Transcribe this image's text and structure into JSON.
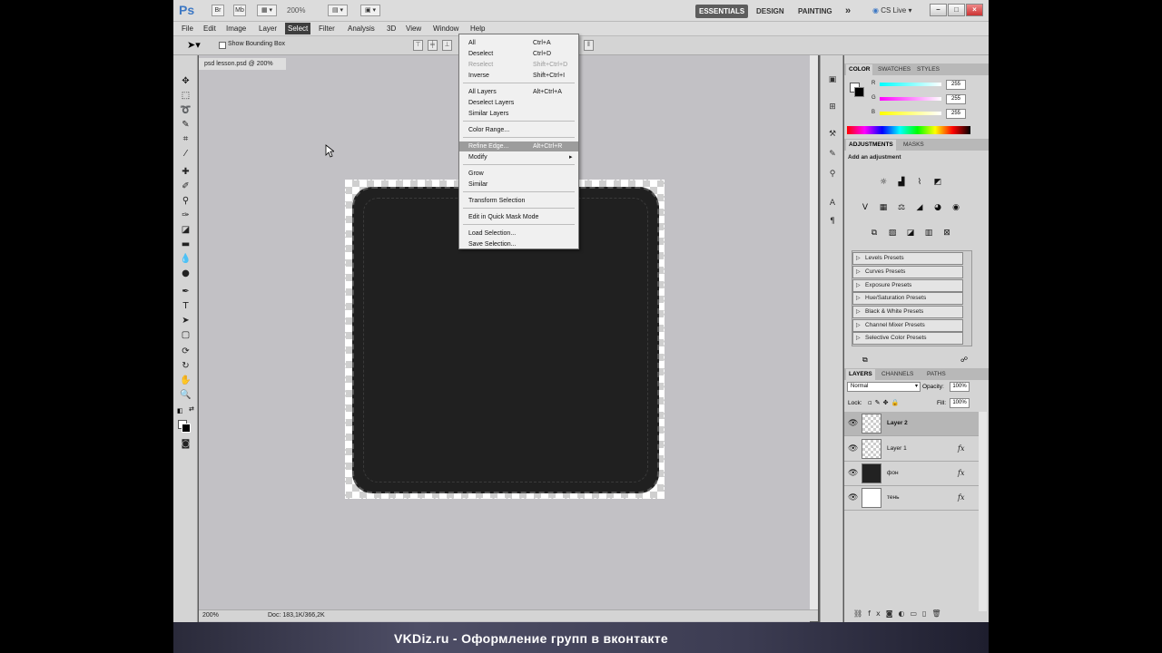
{
  "app": {
    "logo": "Ps",
    "bar_buttons": [
      "Br",
      "Mb"
    ],
    "zoom": "200%",
    "workspaces": [
      "ESSENTIALS",
      "DESIGN",
      "PAINTING"
    ],
    "more": "»",
    "cs_live": "CS Live",
    "window_controls": [
      "–",
      "□",
      "×"
    ]
  },
  "menubar": [
    "File",
    "Edit",
    "Image",
    "Layer",
    "Select",
    "Filter",
    "Analysis",
    "3D",
    "View",
    "Window",
    "Help"
  ],
  "options": {
    "show_bounding_box": "Show Bounding Box"
  },
  "document": {
    "tab": "psd lesson.psd @ 200%"
  },
  "status": {
    "zoom": "200%",
    "doc": "Doc: 183,1K/366,2K"
  },
  "select_menu": [
    {
      "label": "All",
      "shortcut": "Ctrl+A"
    },
    {
      "label": "Deselect",
      "shortcut": "Ctrl+D"
    },
    {
      "label": "Reselect",
      "shortcut": "Shift+Ctrl+D",
      "disabled": true
    },
    {
      "label": "Inverse",
      "shortcut": "Shift+Ctrl+I"
    },
    {
      "label": "All Layers",
      "shortcut": "Alt+Ctrl+A"
    },
    {
      "label": "Deselect Layers",
      "shortcut": ""
    },
    {
      "label": "Similar Layers",
      "shortcut": ""
    },
    {
      "label": "Color Range...",
      "shortcut": ""
    },
    {
      "label": "Refine Edge...",
      "shortcut": "Alt+Ctrl+R",
      "highlighted": true
    },
    {
      "label": "Modify",
      "shortcut": "▸"
    },
    {
      "label": "Grow",
      "shortcut": ""
    },
    {
      "label": "Similar",
      "shortcut": ""
    },
    {
      "label": "Transform Selection",
      "shortcut": ""
    },
    {
      "label": "Edit in Quick Mask Mode",
      "shortcut": ""
    },
    {
      "label": "Load Selection...",
      "shortcut": ""
    },
    {
      "label": "Save Selection...",
      "shortcut": ""
    }
  ],
  "color_panel": {
    "tabs": [
      "COLOR",
      "SWATCHES",
      "STYLES"
    ],
    "channels": [
      {
        "label": "R",
        "value": "255"
      },
      {
        "label": "G",
        "value": "255"
      },
      {
        "label": "B",
        "value": "255"
      }
    ]
  },
  "adjustments_panel": {
    "tabs": [
      "ADJUSTMENTS",
      "MASKS"
    ],
    "heading": "Add an adjustment",
    "presets": [
      "Levels Presets",
      "Curves Presets",
      "Exposure Presets",
      "Hue/Saturation Presets",
      "Black & White Presets",
      "Channel Mixer Presets",
      "Selective Color Presets"
    ]
  },
  "layers_panel": {
    "tabs": [
      "LAYERS",
      "CHANNELS",
      "PATHS"
    ],
    "blend_mode": "Normal",
    "opacity_label": "Opacity:",
    "opacity": "100%",
    "lock_label": "Lock:",
    "fill_label": "Fill:",
    "fill": "100%",
    "layers": [
      {
        "name": "Layer 2",
        "fx": "",
        "selected": true
      },
      {
        "name": "Layer 1",
        "fx": "fx",
        "selected": false
      },
      {
        "name": "фон",
        "fx": "fx",
        "selected": false
      },
      {
        "name": "тень",
        "fx": "fx",
        "selected": false
      }
    ]
  },
  "banner": {
    "text": "VKDiz.ru  -  Оформление групп в вконтакте"
  }
}
